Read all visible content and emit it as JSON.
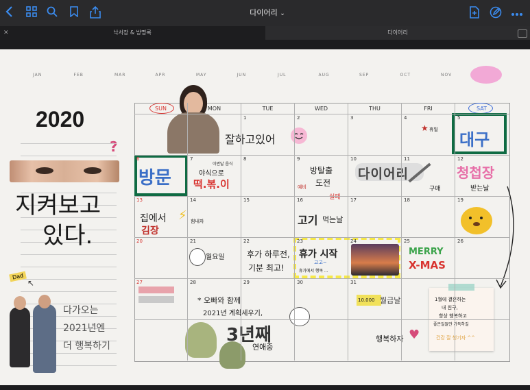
{
  "toolbar": {
    "title": "다이어리",
    "title_chevron": "⌄"
  },
  "tabs": [
    {
      "label": "낙서장 & 방명록",
      "active": false
    },
    {
      "label": "다이어리",
      "active": true
    }
  ],
  "months": [
    "JAN",
    "FEB",
    "MAR",
    "APR",
    "MAY",
    "JUN",
    "JUL",
    "AUG",
    "SEP",
    "OCT",
    "NOV",
    "DEC"
  ],
  "selected_month": "DEC",
  "year": "2020",
  "left_text": {
    "line1": "지켜보고",
    "line2": "있다.",
    "dad_label": "Dad",
    "coming1": "다가오는",
    "coming2": "2021년엔",
    "coming3": "더 행복하기"
  },
  "weekdays": [
    "SUN",
    "MON",
    "TUE",
    "WED",
    "THU",
    "FRI",
    "SAT"
  ],
  "days": {
    "d1": "1",
    "d2": "2",
    "d3": "3",
    "d4": "4",
    "d5": "5",
    "d6": "6",
    "d7": "7",
    "d8": "8",
    "d9": "9",
    "d10": "10",
    "d11": "11",
    "d12": "12",
    "d13": "13",
    "d14": "14",
    "d15": "15",
    "d16": "16",
    "d17": "17",
    "d18": "18",
    "d19": "19",
    "d20": "20",
    "d21": "21",
    "d22": "22",
    "d23": "23",
    "d24": "24",
    "d25": "25",
    "d26": "26",
    "d27": "27",
    "d28": "28",
    "d29": "29",
    "d30": "30",
    "d31": "31"
  },
  "notes": {
    "doing_well": "잘하고있어",
    "daegu": "대구",
    "visit": "방문",
    "food_small": "이번달 음식",
    "tteokbokki_pre": "야식으로",
    "tteokbokki": "떡.볶.이",
    "bangtal_1": "방탈출",
    "bangtal_2": "도전",
    "bangtal_fail": "실패",
    "bangtal_ex": "예비",
    "diary_label": "다이어리",
    "diary_buy": "구매",
    "wedding_1": "청첩장",
    "wedding_2": "받는날",
    "kimjang_1": "집에서",
    "kimjang_2": "김장",
    "kimjang_help": "힘내자",
    "meat_1": "고기",
    "meat_2": "먹는날",
    "day_off": "월요일",
    "vacation_1": "후가 하루전,",
    "vacation_2": "기분 최고!",
    "vac_start": "휴가 시작",
    "vac_sub": "휴가에서 행복 ...",
    "vac_blue": "고고~",
    "merry": "MERRY",
    "xmas": "X-MAS",
    "plan_1": "* 오빠와 함께",
    "plan_2": "2021년 계획세우기,",
    "third_year": "3년째",
    "dating": "연애중",
    "pay_1": "10.000",
    "pay_2": "월급날",
    "happy": "행복하자",
    "note_1": "1월에 결혼하는",
    "note_2": "내 친구,",
    "note_3": "항상 행복하고",
    "note_4": "좋은일들만 가득하길",
    "note_5": "건강 잘 챙기자 ^^",
    "rest_sticker": "휴일"
  },
  "colors": {
    "accent_blue": "#3b8cf0",
    "green_frame": "#0f6b43",
    "pink_month": "#f2a9d6",
    "red_sun": "#d8332f",
    "highlight_yellow": "#f7e947"
  }
}
